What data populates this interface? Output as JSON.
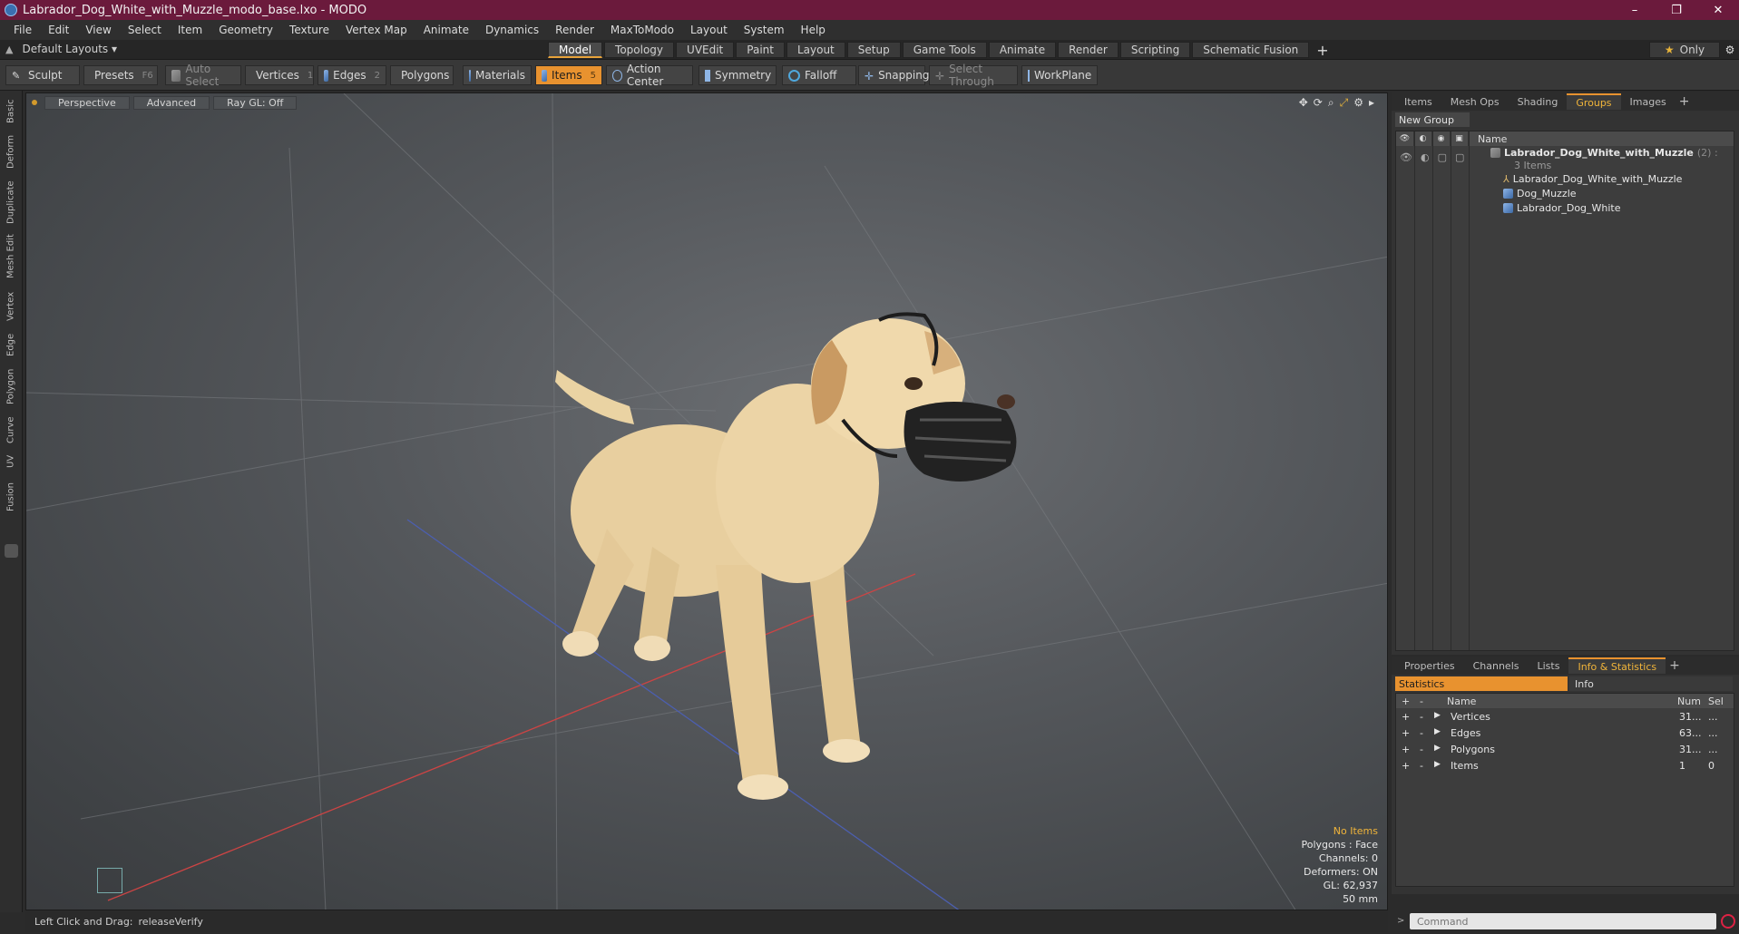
{
  "window": {
    "title": "Labrador_Dog_White_with_Muzzle_modo_base.lxo - MODO",
    "controls": [
      "–",
      "❐",
      "✕"
    ]
  },
  "menu": [
    "File",
    "Edit",
    "View",
    "Select",
    "Item",
    "Geometry",
    "Texture",
    "Vertex Map",
    "Animate",
    "Dynamics",
    "Render",
    "MaxToModo",
    "Layout",
    "System",
    "Help"
  ],
  "layout": {
    "preset": "Default Layouts ▾",
    "tabs": [
      "Model",
      "Topology",
      "UVEdit",
      "Paint",
      "Layout",
      "Setup",
      "Game Tools",
      "Animate",
      "Render",
      "Scripting",
      "Schematic Fusion"
    ],
    "active_tab": "Model",
    "plus": "+",
    "only_label": "Only"
  },
  "toolbar": {
    "sculpt": "Sculpt",
    "presets": "Presets",
    "presets_key": "F6",
    "auto_select": "Auto Select",
    "vertices": "Vertices",
    "vertices_key": "1",
    "edges": "Edges",
    "edges_key": "2",
    "polygons": "Polygons",
    "materials": "Materials",
    "items": "Items",
    "items_key": "5",
    "action_center": "Action Center",
    "symmetry": "Symmetry",
    "falloff": "Falloff",
    "snapping": "Snapping",
    "select_through": "Select Through",
    "workplane": "WorkPlane"
  },
  "left_tabs": [
    "Basic",
    "Deform",
    "Duplicate",
    "Mesh Edit",
    "Vertex",
    "Edge",
    "Polygon",
    "Curve",
    "UV",
    "Fusion"
  ],
  "viewport": {
    "view": "Perspective",
    "shading": "Advanced",
    "raygl": "Ray GL: Off",
    "info": {
      "selection": "No Items",
      "polygons": "Polygons : Face",
      "channels": "Channels: 0",
      "deformers": "Deformers: ON",
      "gl": "GL: 62,937",
      "focal": "50 mm"
    }
  },
  "status": {
    "hint_label": "Left Click and Drag:",
    "hint_value": "releaseVerify"
  },
  "groups_panel": {
    "tabs": [
      "Items",
      "Mesh Ops",
      "Shading",
      "Groups",
      "Images"
    ],
    "active_tab": "Groups",
    "new_group": "New Group",
    "column_name": "Name",
    "root": {
      "label": "Labrador_Dog_White_with_Muzzle",
      "count": "(2) :",
      "sub": "3 Items"
    },
    "children": [
      "Labrador_Dog_White_with_Muzzle",
      "Dog_Muzzle",
      "Labrador_Dog_White"
    ]
  },
  "stats_panel": {
    "tabs": [
      "Properties",
      "Channels",
      "Lists",
      "Info & Statistics"
    ],
    "active_tab": "Info & Statistics",
    "stats_tab": "Statistics",
    "info_tab": "Info",
    "columns": {
      "name": "Name",
      "num": "Num",
      "sel": "Sel"
    },
    "rows": [
      {
        "name": "Vertices",
        "num": "31...",
        "sel": "..."
      },
      {
        "name": "Edges",
        "num": "63...",
        "sel": "..."
      },
      {
        "name": "Polygons",
        "num": "31...",
        "sel": "..."
      },
      {
        "name": "Items",
        "num": "1",
        "sel": "0"
      }
    ]
  },
  "command": {
    "placeholder": "Command"
  },
  "colors": {
    "title_bar": "#6b1a3c",
    "accent": "#e8922f"
  }
}
